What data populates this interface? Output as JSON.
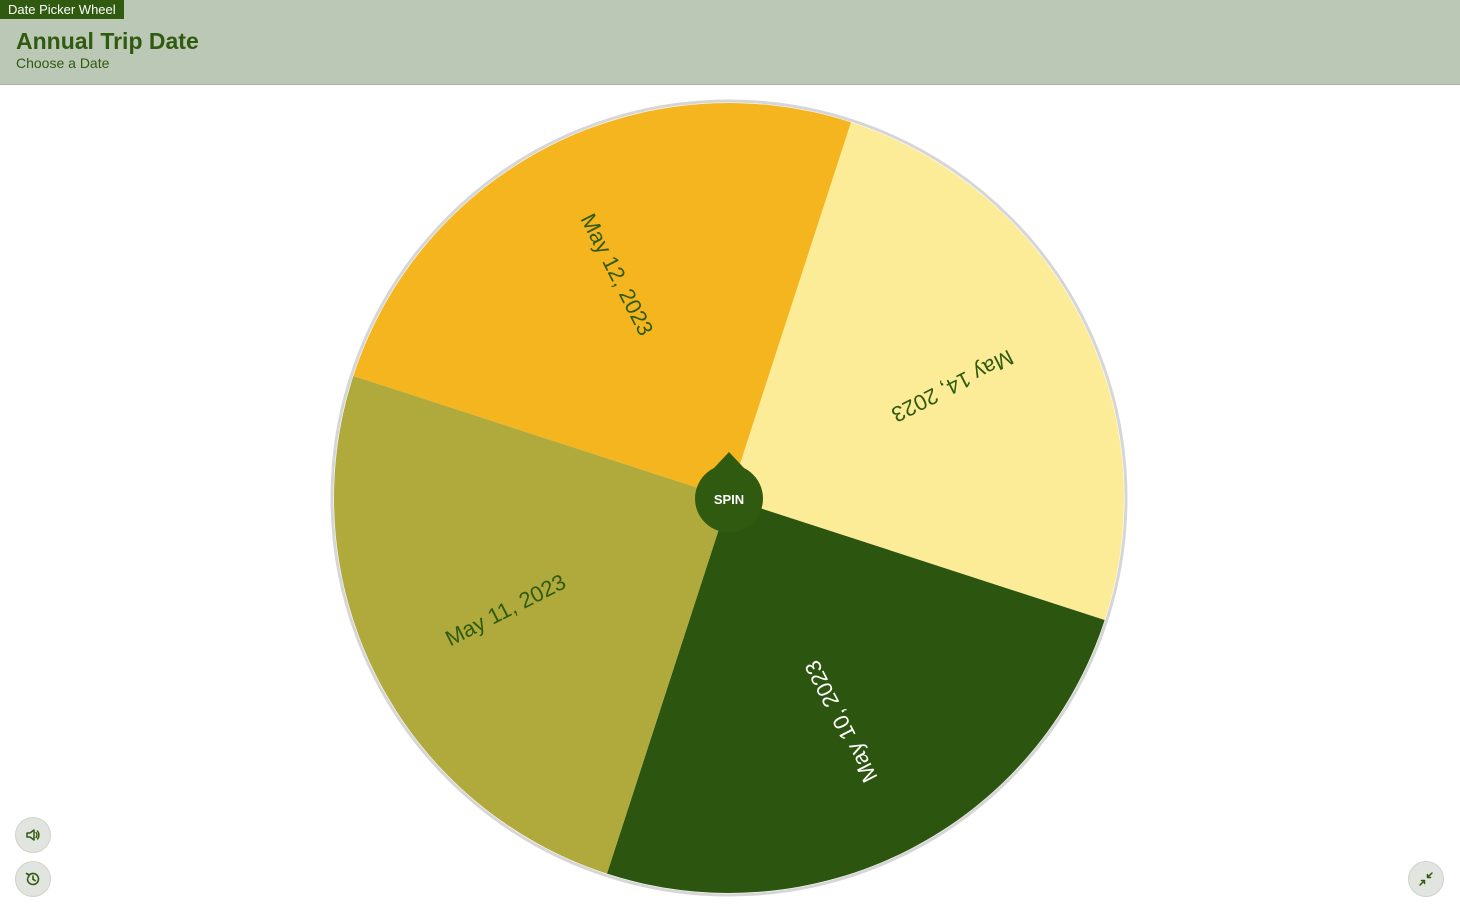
{
  "app": {
    "badge": "Date Picker Wheel",
    "title": "Annual Trip Date",
    "subtitle": "Choose a Date"
  },
  "wheel": {
    "spin_label": "SPIN",
    "spin_color": "#2f5a0f",
    "slices": [
      {
        "label": "May 12, 2023",
        "color": "#f5b51e",
        "text_color": "#2f5a0f"
      },
      {
        "label": "May 14, 2023",
        "color": "#fdec97",
        "text_color": "#2f5a0f"
      },
      {
        "label": "May 10, 2023",
        "color": "#2c560f",
        "text_color": "#ffffff"
      },
      {
        "label": "May 11, 2023",
        "color": "#afaa3b",
        "text_color": "#2f5a0f"
      }
    ]
  },
  "controls": {
    "sound_icon": "speaker-icon",
    "history_icon": "history-icon",
    "collapse_icon": "collapse-icon"
  },
  "colors": {
    "header_bg": "#bcc8b6",
    "accent": "#2f5a0f"
  }
}
